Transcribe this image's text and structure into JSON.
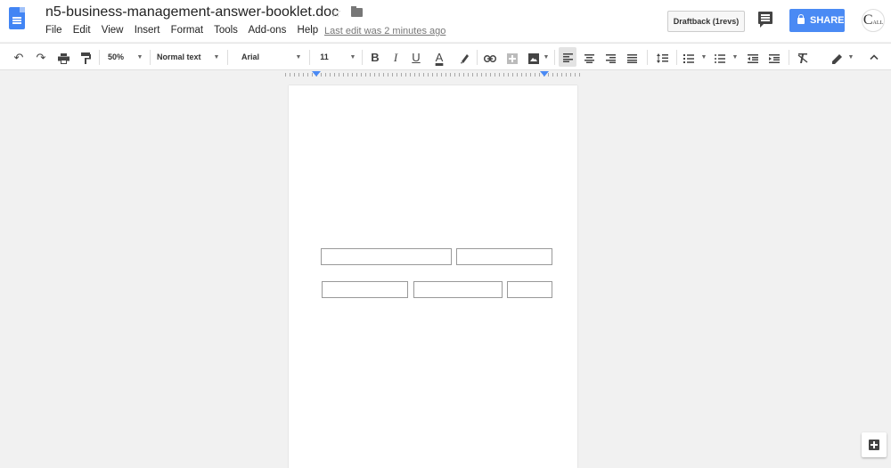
{
  "window": {
    "doc_title": "n5-business-management-answer-booklet.doc",
    "last_edit": "Last edit was 2 minutes ago"
  },
  "menu": [
    "File",
    "Edit",
    "View",
    "Insert",
    "Format",
    "Tools",
    "Add-ons",
    "Help"
  ],
  "header_buttons": {
    "draftback": "Draftback (1revs)",
    "share": "SHARE",
    "avatar": "C",
    "avatar_small": "ALL"
  },
  "toolbar": {
    "zoom": "50%",
    "style": "Normal text",
    "font": "Arial",
    "font_size": "11",
    "bold": "B",
    "italic": "I",
    "underline": "U",
    "text_color": "A"
  },
  "icons": {
    "undo": "undo-icon",
    "redo": "redo-icon",
    "print": "print-icon",
    "paint_format": "paint-format-icon",
    "highlight": "highlight-icon",
    "link": "link-icon",
    "comment": "add-comment-icon",
    "image": "image-icon",
    "align_left": "align-left-icon",
    "align_center": "align-center-icon",
    "align_right": "align-right-icon",
    "justify": "justify-icon",
    "line_spacing": "line-spacing-icon",
    "numbered_list": "numbered-list-icon",
    "bulleted_list": "bulleted-list-icon",
    "indent_decrease": "decrease-indent-icon",
    "indent_increase": "increase-indent-icon",
    "clear_format": "clear-formatting-icon",
    "editing_mode": "pencil-icon",
    "collapse": "chevron-up-icon",
    "explore": "explore-icon"
  },
  "colors": {
    "accent": "#4a8af4",
    "doc_icon": "#4285f4",
    "canvas": "#f1f1f1"
  }
}
